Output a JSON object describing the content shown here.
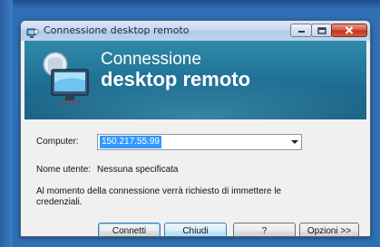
{
  "window": {
    "title": "Connessione desktop remoto"
  },
  "banner": {
    "line1": "Connessione",
    "line2": "desktop remoto"
  },
  "form": {
    "computer_label": "Computer:",
    "computer_value": "150.217.55.99",
    "username_label": "Nome utente:",
    "username_value": "Nessuna specificata",
    "description": "Al momento della connessione verrà richiesto di immettere le credenziali."
  },
  "buttons": {
    "connect": "Connetti",
    "close": "Chiudi",
    "help": "?",
    "options": "Opzioni >>"
  },
  "colors": {
    "desktop": "#2f6fb4",
    "banner": "#1f6f93",
    "selection": "#3399ff"
  }
}
